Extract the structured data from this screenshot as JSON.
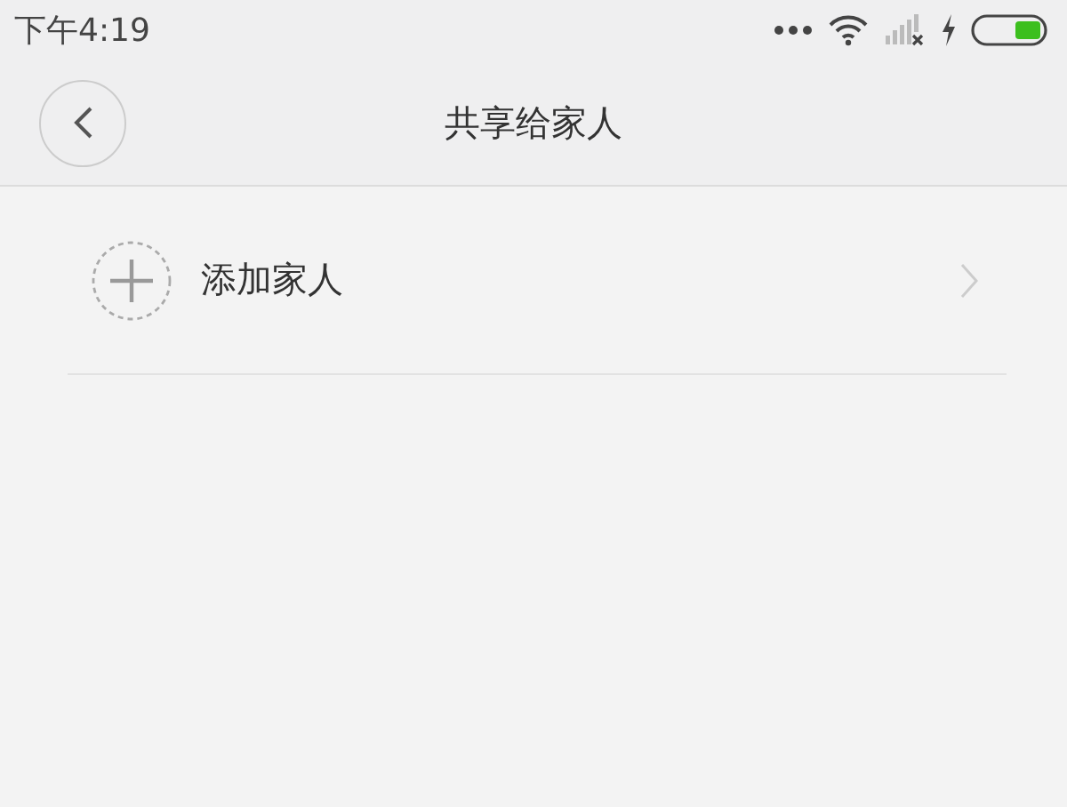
{
  "status_bar": {
    "time": "下午4:19"
  },
  "header": {
    "title": "共享给家人"
  },
  "items": [
    {
      "label": "添加家人"
    }
  ]
}
